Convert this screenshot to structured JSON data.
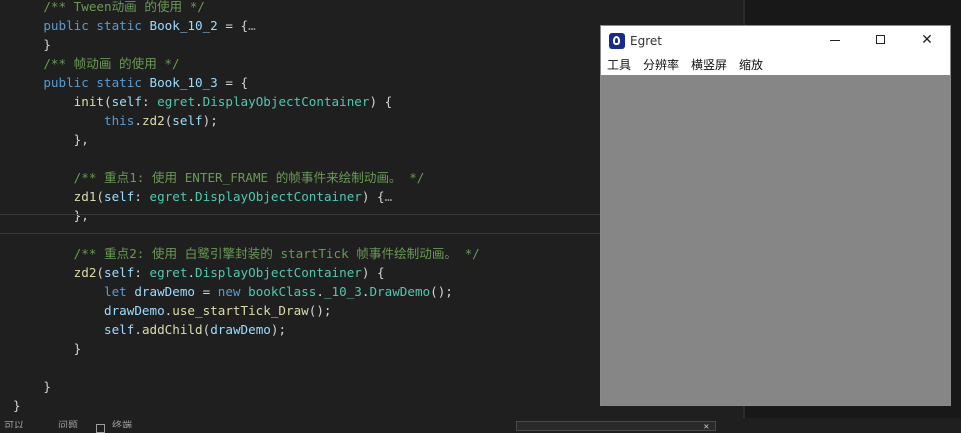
{
  "editor": {
    "lines": [
      {
        "segs": [
          {
            "t": "    ",
            "c": "pn"
          },
          {
            "t": "/** Tween动画 的使用 */",
            "c": "cm"
          }
        ]
      },
      {
        "segs": [
          {
            "t": "    ",
            "c": "pn"
          },
          {
            "t": "public ",
            "c": "k1"
          },
          {
            "t": "static ",
            "c": "k1"
          },
          {
            "t": "Book_10_2",
            "c": "va"
          },
          {
            "t": " = {",
            "c": "pn"
          },
          {
            "t": "…",
            "c": "fold"
          }
        ]
      },
      {
        "segs": [
          {
            "t": "    }",
            "c": "pn"
          }
        ]
      },
      {
        "segs": [
          {
            "t": "    ",
            "c": "pn"
          },
          {
            "t": "/** 帧动画 的使用 */",
            "c": "cm"
          }
        ]
      },
      {
        "segs": [
          {
            "t": "    ",
            "c": "pn"
          },
          {
            "t": "public ",
            "c": "k1"
          },
          {
            "t": "static ",
            "c": "k1"
          },
          {
            "t": "Book_10_3",
            "c": "va"
          },
          {
            "t": " = {",
            "c": "pn"
          }
        ]
      },
      {
        "segs": [
          {
            "t": "        ",
            "c": "pn"
          },
          {
            "t": "init",
            "c": "fn"
          },
          {
            "t": "(",
            "c": "pn"
          },
          {
            "t": "self",
            "c": "va"
          },
          {
            "t": ": ",
            "c": "pn"
          },
          {
            "t": "egret",
            "c": "ty"
          },
          {
            "t": ".",
            "c": "pn"
          },
          {
            "t": "DisplayObjectContainer",
            "c": "ty"
          },
          {
            "t": ") {",
            "c": "pn"
          }
        ]
      },
      {
        "segs": [
          {
            "t": "            ",
            "c": "pn"
          },
          {
            "t": "this",
            "c": "k1"
          },
          {
            "t": ".",
            "c": "pn"
          },
          {
            "t": "zd2",
            "c": "fn"
          },
          {
            "t": "(",
            "c": "pn"
          },
          {
            "t": "self",
            "c": "va"
          },
          {
            "t": ");",
            "c": "pn"
          }
        ]
      },
      {
        "segs": [
          {
            "t": "        },",
            "c": "pn"
          }
        ]
      },
      {
        "segs": [
          {
            "t": "",
            "c": "pn"
          }
        ]
      },
      {
        "segs": [
          {
            "t": "        ",
            "c": "pn"
          },
          {
            "t": "/** 重点1: 使用 ENTER_FRAME 的帧事件来绘制动画。 */",
            "c": "cm"
          }
        ]
      },
      {
        "segs": [
          {
            "t": "        ",
            "c": "pn"
          },
          {
            "t": "zd1",
            "c": "fn"
          },
          {
            "t": "(",
            "c": "pn"
          },
          {
            "t": "self",
            "c": "va"
          },
          {
            "t": ": ",
            "c": "pn"
          },
          {
            "t": "egret",
            "c": "ty"
          },
          {
            "t": ".",
            "c": "pn"
          },
          {
            "t": "DisplayObjectContainer",
            "c": "ty"
          },
          {
            "t": ") {",
            "c": "pn"
          },
          {
            "t": "…",
            "c": "fold"
          }
        ]
      },
      {
        "segs": [
          {
            "t": "        },",
            "c": "pn"
          }
        ]
      },
      {
        "segs": [
          {
            "t": "",
            "c": "pn"
          }
        ]
      },
      {
        "segs": [
          {
            "t": "        ",
            "c": "pn"
          },
          {
            "t": "/** 重点2: 使用 白鹭引擎封装的 startTick 帧事件绘制动画。 */",
            "c": "cm"
          }
        ]
      },
      {
        "segs": [
          {
            "t": "        ",
            "c": "pn"
          },
          {
            "t": "zd2",
            "c": "fn"
          },
          {
            "t": "(",
            "c": "pn"
          },
          {
            "t": "self",
            "c": "va"
          },
          {
            "t": ": ",
            "c": "pn"
          },
          {
            "t": "egret",
            "c": "ty"
          },
          {
            "t": ".",
            "c": "pn"
          },
          {
            "t": "DisplayObjectContainer",
            "c": "ty"
          },
          {
            "t": ") {",
            "c": "pn"
          }
        ]
      },
      {
        "segs": [
          {
            "t": "            ",
            "c": "pn"
          },
          {
            "t": "let ",
            "c": "k1"
          },
          {
            "t": "drawDemo",
            "c": "va"
          },
          {
            "t": " = ",
            "c": "pn"
          },
          {
            "t": "new ",
            "c": "k1"
          },
          {
            "t": "bookClass",
            "c": "ty"
          },
          {
            "t": ".",
            "c": "pn"
          },
          {
            "t": "_10_3",
            "c": "ty"
          },
          {
            "t": ".",
            "c": "pn"
          },
          {
            "t": "DrawDemo",
            "c": "ty"
          },
          {
            "t": "();",
            "c": "pn"
          }
        ]
      },
      {
        "segs": [
          {
            "t": "            ",
            "c": "pn"
          },
          {
            "t": "drawDemo",
            "c": "va"
          },
          {
            "t": ".",
            "c": "pn"
          },
          {
            "t": "use_startTick_Draw",
            "c": "fn"
          },
          {
            "t": "();",
            "c": "pn"
          }
        ]
      },
      {
        "segs": [
          {
            "t": "            ",
            "c": "pn"
          },
          {
            "t": "self",
            "c": "va"
          },
          {
            "t": ".",
            "c": "pn"
          },
          {
            "t": "addChild",
            "c": "fn"
          },
          {
            "t": "(",
            "c": "pn"
          },
          {
            "t": "drawDemo",
            "c": "va"
          },
          {
            "t": ");",
            "c": "pn"
          }
        ]
      },
      {
        "segs": [
          {
            "t": "        }",
            "c": "pn"
          }
        ]
      },
      {
        "segs": [
          {
            "t": "",
            "c": "pn"
          }
        ]
      },
      {
        "segs": [
          {
            "t": "    }",
            "c": "pn"
          }
        ]
      },
      {
        "segs": [
          {
            "t": "}",
            "c": "pn"
          }
        ]
      }
    ]
  },
  "bottom_bar": {
    "items": [
      "可以",
      "问题",
      "终端"
    ]
  },
  "egret_window": {
    "title": "Egret",
    "close_glyph": "✕",
    "menu": [
      "工具",
      "分辨率",
      "横竖屏",
      "缩放"
    ]
  },
  "colors": {
    "canvas": "#868686",
    "editor_bg": "#1f1f1f",
    "comment": "#6a9955",
    "keyword": "#569cd6"
  }
}
